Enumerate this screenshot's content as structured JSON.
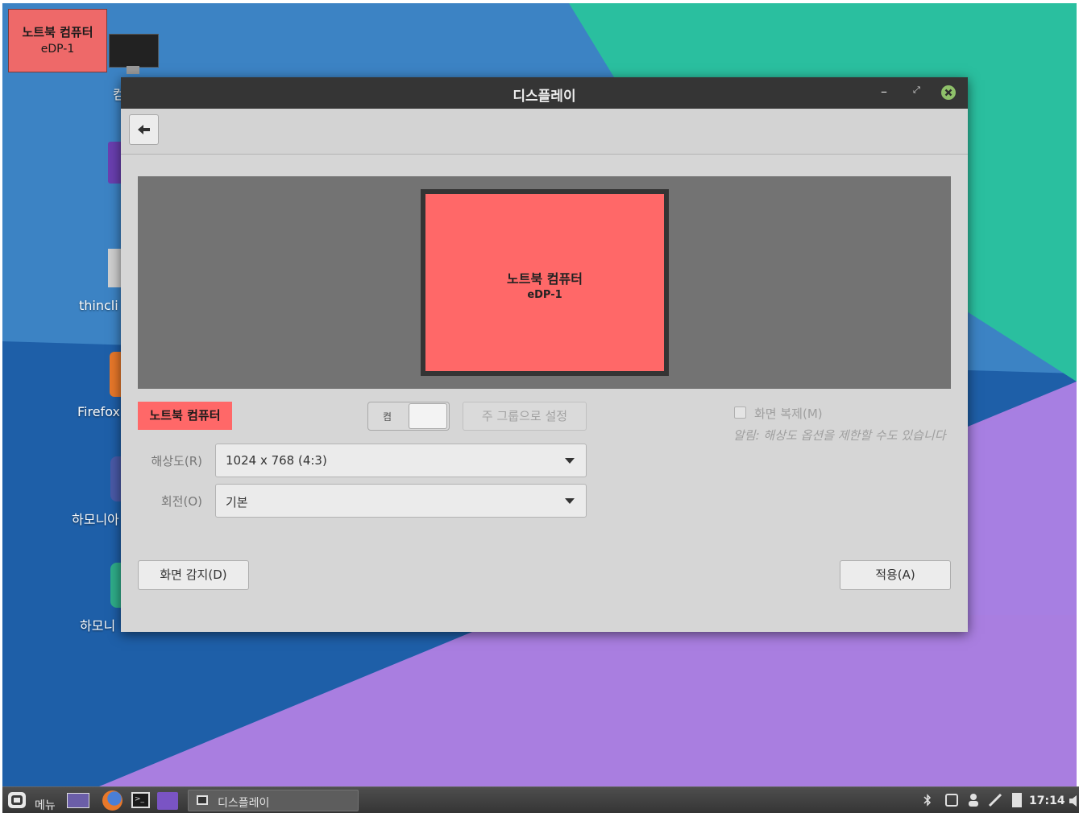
{
  "identify_popup": {
    "name": "노트북 컴퓨터",
    "port": "eDP-1"
  },
  "desktop": {
    "icons": [
      {
        "label": "컴",
        "icon": "computer-icon"
      },
      {
        "label": "",
        "icon": "folder-icon"
      },
      {
        "label": "thincli",
        "icon": "thinclient-icon"
      },
      {
        "label": "Firefox",
        "icon": "firefox-icon"
      },
      {
        "label": "하모니아",
        "icon": "harmonia-icon"
      },
      {
        "label": "하모니",
        "icon": "harmonia-tools-icon"
      }
    ]
  },
  "window": {
    "title": "디스플레이",
    "controls": {
      "minimize": "–",
      "maximize": "⤢",
      "close": "close-icon"
    }
  },
  "toolbar": {
    "back_icon": "back-arrow-icon"
  },
  "arrangement": {
    "monitor_name": "노트북 컴퓨터",
    "monitor_port": "eDP-1",
    "monitor_color": "#ff6868"
  },
  "output": {
    "name": "노트북 컴퓨터",
    "switch_label": "켬",
    "set_primary_label": "주 그룹으로 설정",
    "mirror_label": "화면 복제(M)",
    "mirror_note": "알림: 해상도 옵션을 제한할 수도 있습니다",
    "resolution_label": "해상도(R)",
    "resolution_value": "1024 x 768 (4:3)",
    "rotation_label": "회전(O)",
    "rotation_value": "기본"
  },
  "buttons": {
    "detect": "화면 감지(D)",
    "apply": "적용(A)"
  },
  "taskbar": {
    "menu_label": "메뉴",
    "task_label": "디스플레이",
    "clock": "17:14",
    "tray_icons": [
      "bluetooth-icon",
      "network-icon",
      "user-icon",
      "pen-icon",
      "battery-icon",
      "volume-icon"
    ]
  }
}
